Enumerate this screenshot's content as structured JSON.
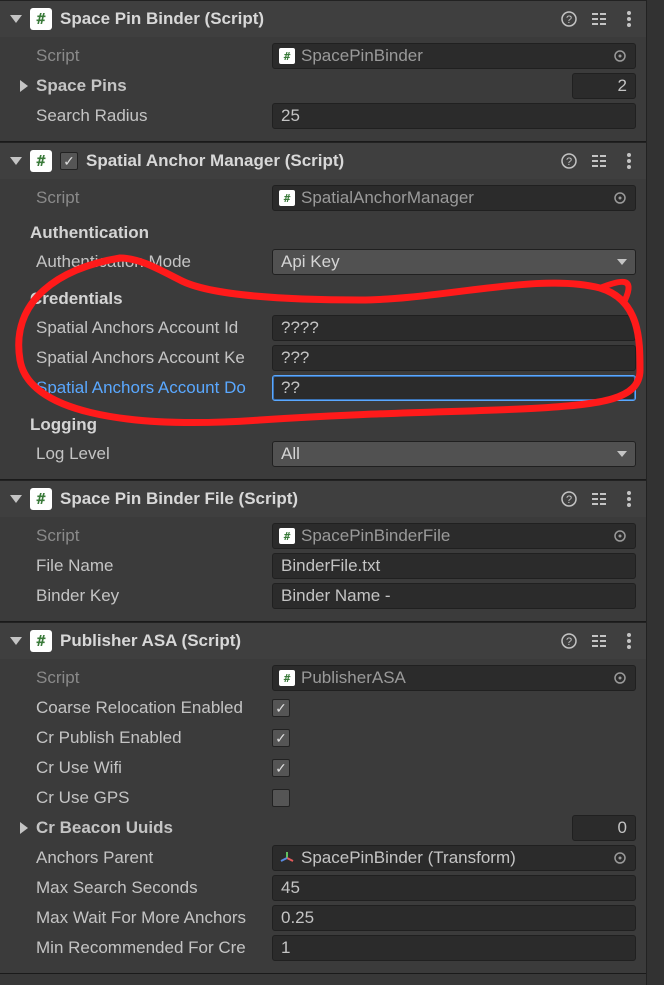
{
  "components": {
    "spacePinBinder": {
      "title": "Space Pin Binder (Script)",
      "scriptLabel": "Script",
      "scriptValue": "SpacePinBinder",
      "spacePinsLabel": "Space Pins",
      "spacePinsCount": "2",
      "searchRadiusLabel": "Search Radius",
      "searchRadiusValue": "25"
    },
    "spatialAnchorManager": {
      "title": "Spatial Anchor Manager (Script)",
      "scriptLabel": "Script",
      "scriptValue": "SpatialAnchorManager",
      "authHeader": "Authentication",
      "authModeLabel": "Authentication Mode",
      "authModeValue": "Api Key",
      "credsHeader": "Credentials",
      "acctIdLabel": "Spatial Anchors Account Id",
      "acctIdValue": "????",
      "acctKeyLabel": "Spatial Anchors Account Ke",
      "acctKeyValue": "???",
      "acctDomLabel": "Spatial Anchors Account Do",
      "acctDomValue": "??",
      "loggingHeader": "Logging",
      "logLevelLabel": "Log Level",
      "logLevelValue": "All"
    },
    "spacePinBinderFile": {
      "title": "Space Pin Binder File (Script)",
      "scriptLabel": "Script",
      "scriptValue": "SpacePinBinderFile",
      "fileNameLabel": "File Name",
      "fileNameValue": "BinderFile.txt",
      "binderKeyLabel": "Binder Key",
      "binderKeyValue": "Binder Name -"
    },
    "publisherAsa": {
      "title": "Publisher ASA (Script)",
      "scriptLabel": "Script",
      "scriptValue": "PublisherASA",
      "coarseRelocLabel": "Coarse Relocation Enabled",
      "coarseRelocValue": true,
      "crPublishLabel": "Cr Publish Enabled",
      "crPublishValue": true,
      "crWifiLabel": "Cr Use Wifi",
      "crWifiValue": true,
      "crGpsLabel": "Cr Use GPS",
      "crGpsValue": false,
      "beaconUuidsLabel": "Cr Beacon Uuids",
      "beaconUuidsCount": "0",
      "anchorsParentLabel": "Anchors Parent",
      "anchorsParentValue": "SpacePinBinder (Transform)",
      "maxSearchLabel": "Max Search Seconds",
      "maxSearchValue": "45",
      "maxWaitLabel": "Max Wait For More Anchors",
      "maxWaitValue": "0.25",
      "minRecLabel": "Min Recommended For Cre",
      "minRecValue": "1"
    }
  }
}
